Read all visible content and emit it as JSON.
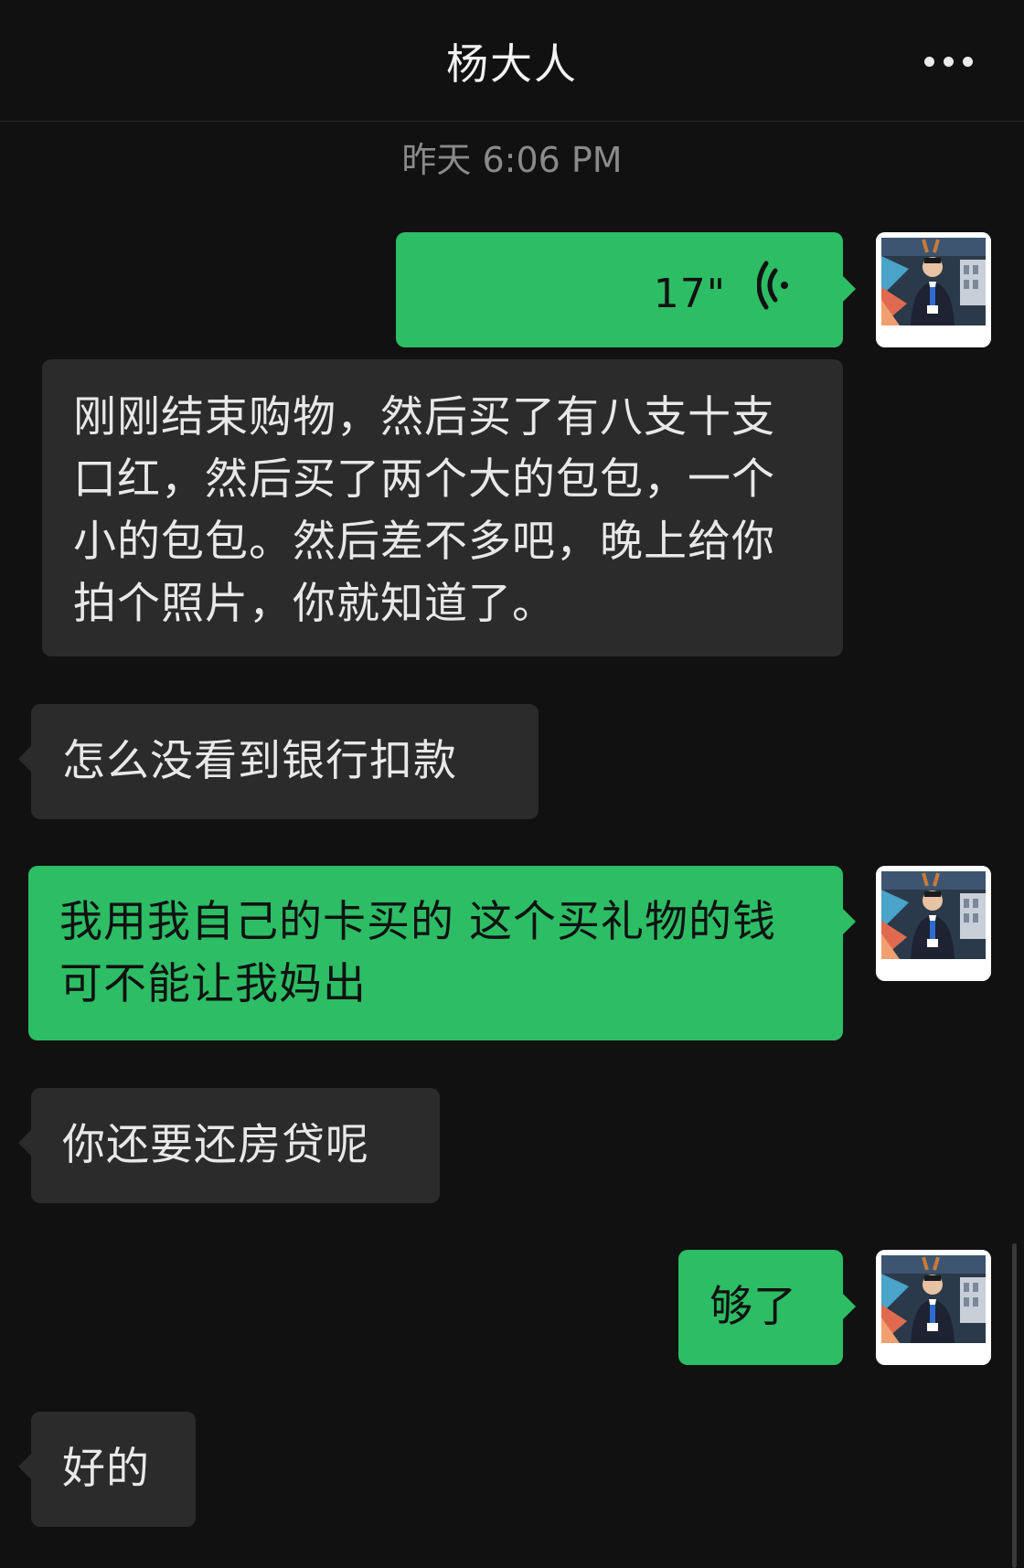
{
  "header": {
    "title": "杨大人",
    "more_icon": "more-dots-icon"
  },
  "timestamp": "昨天 6:06 PM",
  "colors": {
    "background": "#111111",
    "my_bubble": "#2dbd65",
    "other_bubble": "#2b2b2b"
  },
  "messages": [
    {
      "sender": "me",
      "type": "voice",
      "duration": "17\""
    },
    {
      "sender": "me",
      "type": "text",
      "text": "刚刚结束购物，然后买了有八支十支口红，然后买了两个大的包包，一个小的包包。然后差不多吧，晚上给你拍个照片，你就知道了。"
    },
    {
      "sender": "other",
      "type": "text",
      "text": "怎么没看到银行扣款"
    },
    {
      "sender": "me",
      "type": "text",
      "text": "我用我自己的卡买的 这个买礼物的钱可不能让我妈出"
    },
    {
      "sender": "other",
      "type": "text",
      "text": "你还要还房贷呢"
    },
    {
      "sender": "me",
      "type": "text",
      "text": "够了"
    },
    {
      "sender": "other",
      "type": "text",
      "text": "好的"
    }
  ]
}
